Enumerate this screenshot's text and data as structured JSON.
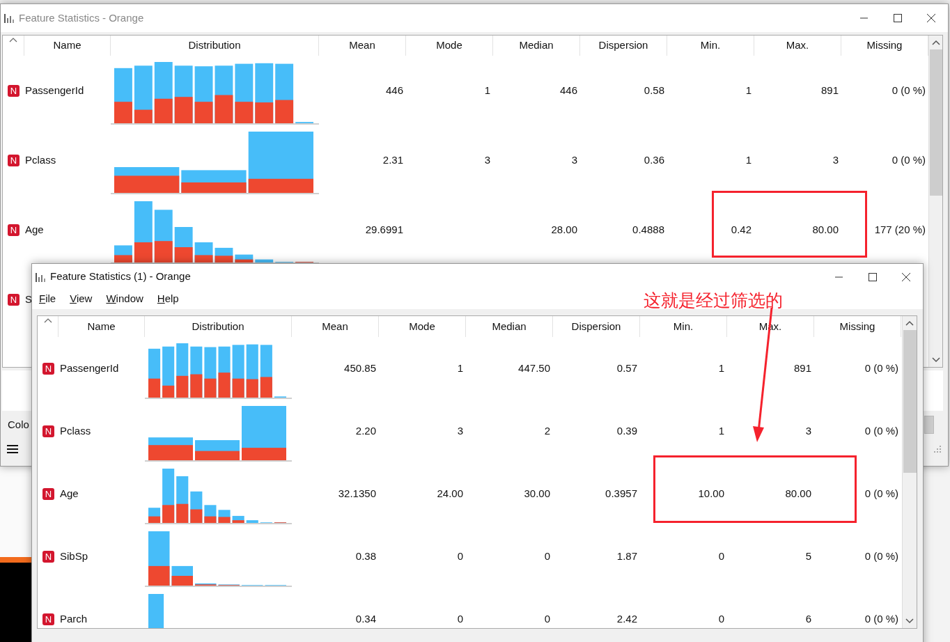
{
  "back_window": {
    "title": "Feature Statistics - Orange",
    "columns": [
      "Name",
      "Distribution",
      "Mean",
      "Mode",
      "Median",
      "Dispersion",
      "Min.",
      "Max.",
      "Missing"
    ],
    "rows": [
      {
        "badge": "N",
        "name": "PassengerId",
        "mean": "446",
        "mode": "1",
        "median": "446",
        "dispersion": "0.58",
        "min": "1",
        "max": "891",
        "missing": "0 (0 %)"
      },
      {
        "badge": "N",
        "name": "Pclass",
        "mean": "2.31",
        "mode": "3",
        "median": "3",
        "dispersion": "0.36",
        "min": "1",
        "max": "3",
        "missing": "0 (0 %)"
      },
      {
        "badge": "N",
        "name": "Age",
        "mean": "29.6991",
        "median": "28.00",
        "dispersion": "0.4888",
        "min": "0.42",
        "max": "80.00",
        "missing": "177 (20 %)"
      },
      {
        "badge": "N",
        "name": "S"
      }
    ],
    "footer_label": "Colo"
  },
  "front_window": {
    "title": "Feature Statistics (1) - Orange",
    "menu": [
      "File",
      "View",
      "Window",
      "Help"
    ],
    "columns": [
      "Name",
      "Distribution",
      "Mean",
      "Mode",
      "Median",
      "Dispersion",
      "Min.",
      "Max.",
      "Missing"
    ],
    "rows": [
      {
        "badge": "N",
        "name": "PassengerId",
        "mean": "450.85",
        "mode": "1",
        "median": "447.50",
        "dispersion": "0.57",
        "min": "1",
        "max": "891",
        "missing": "0 (0 %)"
      },
      {
        "badge": "N",
        "name": "Pclass",
        "mean": "2.20",
        "mode": "3",
        "median": "2",
        "dispersion": "0.39",
        "min": "1",
        "max": "3",
        "missing": "0 (0 %)"
      },
      {
        "badge": "N",
        "name": "Age",
        "mean": "32.1350",
        "mode": "24.00",
        "median": "30.00",
        "dispersion": "0.3957",
        "min": "10.00",
        "max": "80.00",
        "missing": "0 (0 %)"
      },
      {
        "badge": "N",
        "name": "SibSp",
        "mean": "0.38",
        "mode": "0",
        "median": "0",
        "dispersion": "1.87",
        "min": "0",
        "max": "5",
        "missing": "0 (0 %)"
      },
      {
        "badge": "N",
        "name": "Parch",
        "mean": "0.34",
        "mode": "0",
        "median": "0",
        "dispersion": "2.42",
        "min": "0",
        "max": "6",
        "missing": "0 (0 %)"
      }
    ]
  },
  "annotation": {
    "text": "这就是经过筛选的"
  }
}
